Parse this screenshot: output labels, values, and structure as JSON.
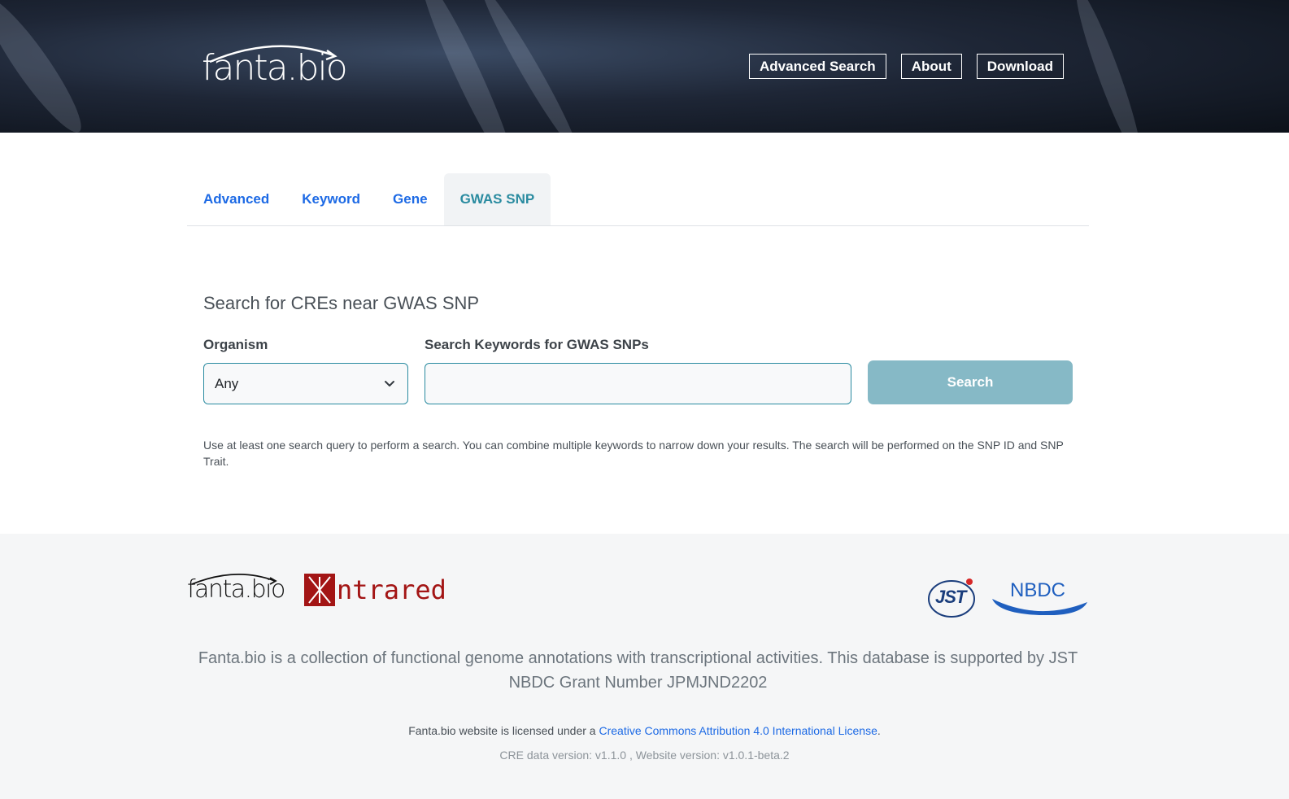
{
  "header": {
    "logo_text": "fanta.bio",
    "nav": [
      {
        "label": "Advanced Search"
      },
      {
        "label": "About"
      },
      {
        "label": "Download"
      }
    ]
  },
  "tabs": [
    {
      "label": "Advanced",
      "active": false
    },
    {
      "label": "Keyword",
      "active": false
    },
    {
      "label": "Gene",
      "active": false
    },
    {
      "label": "GWAS SNP",
      "active": true
    }
  ],
  "form": {
    "title": "Search for CREs near GWAS SNP",
    "organism_label": "Organism",
    "organism_value": "Any",
    "keywords_label": "Search Keywords for GWAS SNPs",
    "keywords_value": "",
    "search_button": "Search",
    "help_text": "Use at least one search query to perform a search. You can combine multiple keywords to narrow down your results. The search will be performed on the SNP ID and SNP Trait."
  },
  "footer": {
    "logos": {
      "fanta": "fanta.bio",
      "intrared": "ntrared",
      "jst": "JST",
      "nbdc": "NBDC"
    },
    "description": "Fanta.bio is a collection of functional genome annotations with transcriptional activities. This database is supported by JST NBDC Grant Number JPMJND2202",
    "license_prefix": "Fanta.bio website is licensed under a ",
    "license_link": "Creative Commons Attribution 4.0 International License",
    "license_suffix": ".",
    "versions": "CRE data version: v1.1.0 , Website version: v1.0.1-beta.2"
  },
  "colors": {
    "accent": "#2a8ba0",
    "link": "#1d6ae5",
    "search_button": "#86b9c6",
    "brand_red": "#a31515",
    "nbdc_blue": "#1f5fbf"
  }
}
